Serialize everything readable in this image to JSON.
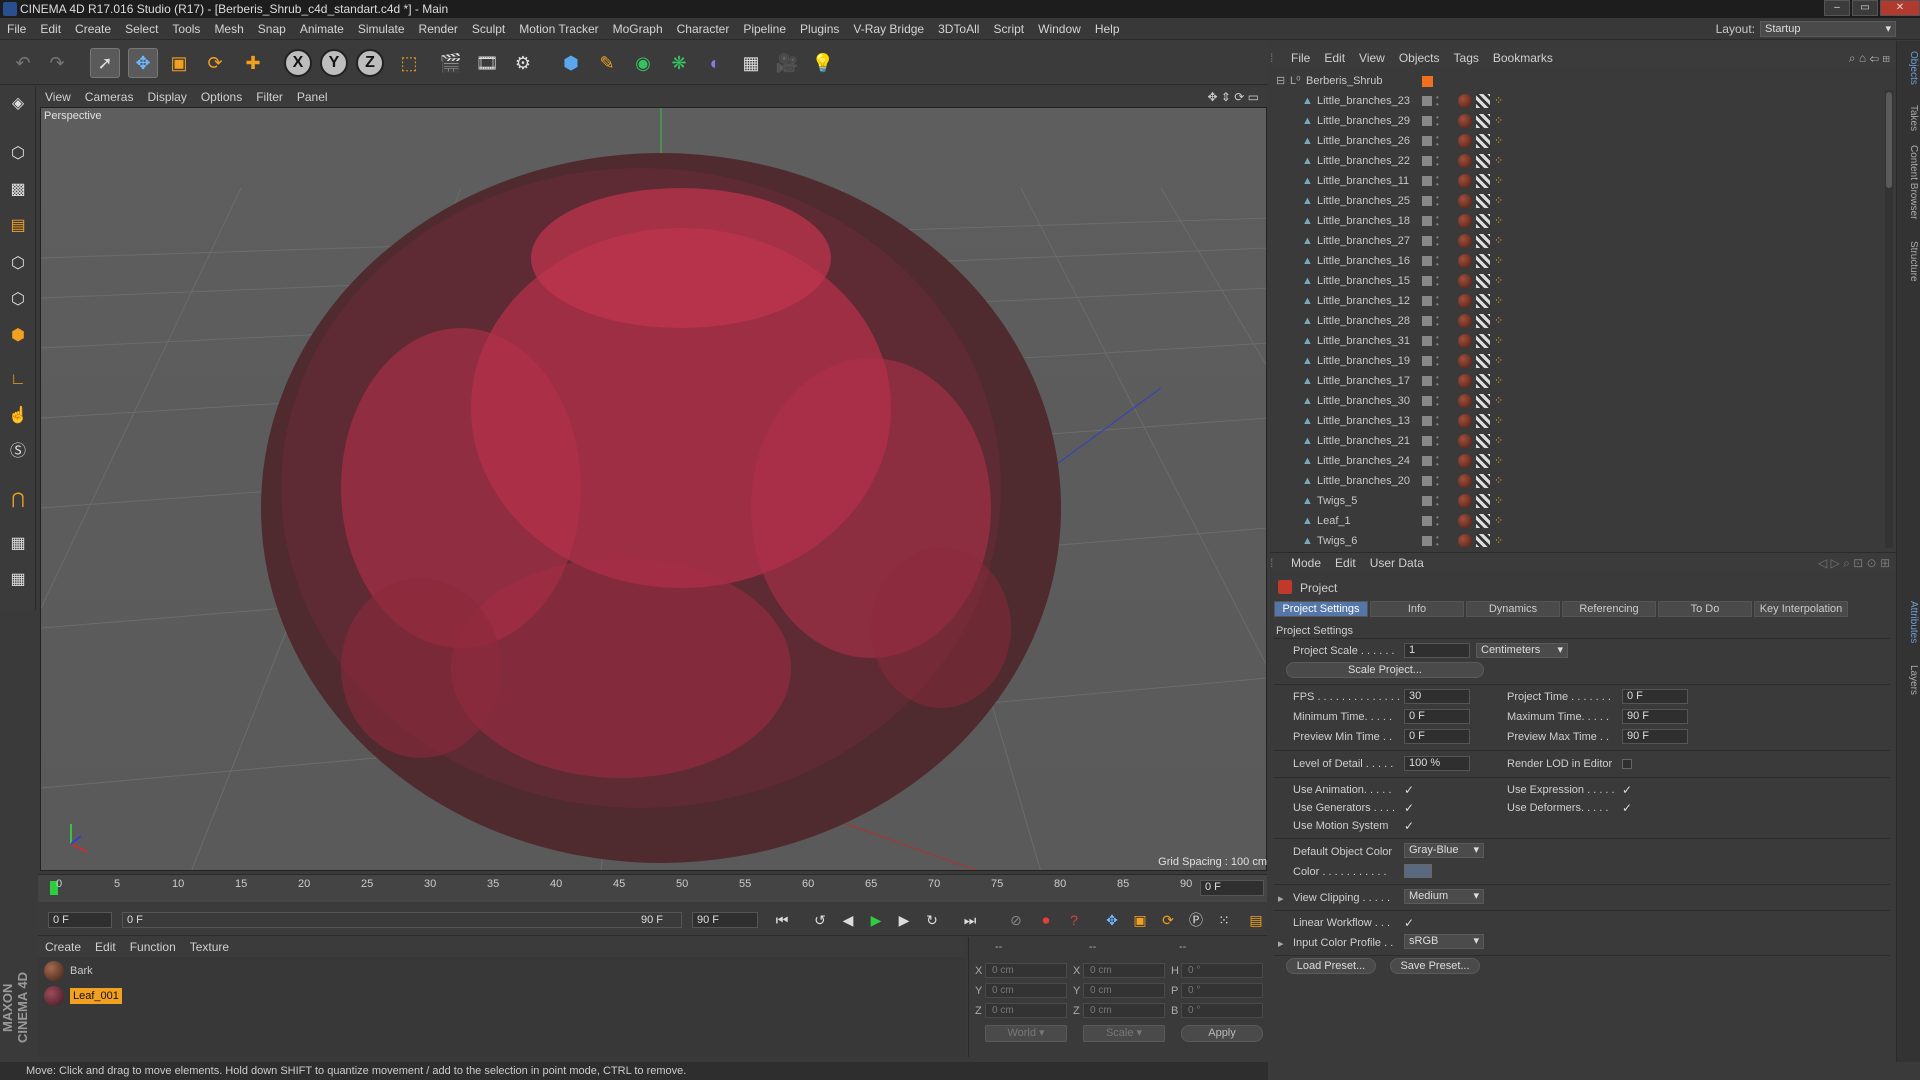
{
  "window": {
    "title": "CINEMA 4D R17.016 Studio (R17) - [Berberis_Shrub_c4d_standart.c4d *] - Main",
    "controls": [
      "–",
      "▭",
      "✕"
    ]
  },
  "menubar": {
    "items": [
      "File",
      "Edit",
      "Create",
      "Select",
      "Tools",
      "Mesh",
      "Snap",
      "Animate",
      "Simulate",
      "Render",
      "Sculpt",
      "Motion Tracker",
      "MoGraph",
      "Character",
      "Pipeline",
      "Plugins",
      "V-Ray Bridge",
      "3DToAll",
      "Script",
      "Window",
      "Help"
    ],
    "layout_label": "Layout:",
    "layout_value": "Startup"
  },
  "top_toolbar": {
    "icons": [
      "undo-icon",
      "redo-icon",
      "live-selection-icon",
      "move-icon",
      "scale-icon",
      "rotate-icon",
      "add-icon",
      "x-axis-icon",
      "y-axis-icon",
      "z-axis-icon",
      "coordinate-system-icon",
      "render-view-icon",
      "render-picture-viewer-icon",
      "edit-render-settings-icon",
      "cube-icon",
      "pen-icon",
      "subdivision-icon",
      "cloner-icon",
      "deformer-icon",
      "floor-icon",
      "camera-icon",
      "light-icon"
    ],
    "axis_labels": [
      "X",
      "Y",
      "Z"
    ]
  },
  "viewport": {
    "menus": [
      "View",
      "Cameras",
      "Display",
      "Options",
      "Filter",
      "Panel"
    ],
    "label": "Perspective",
    "grid_spacing": "Grid Spacing : 100 cm"
  },
  "timeline": {
    "ticks": [
      "0",
      "5",
      "10",
      "15",
      "20",
      "25",
      "30",
      "35",
      "40",
      "45",
      "50",
      "55",
      "60",
      "65",
      "70",
      "75",
      "80",
      "85",
      "90"
    ],
    "current_frame": "0 F",
    "start_field": "0 F",
    "range_start": "0 F",
    "range_end": "90 F",
    "end_field": "90 F"
  },
  "material_manager": {
    "menus": [
      "Create",
      "Edit",
      "Function",
      "Texture"
    ],
    "materials": [
      {
        "name": "Bark",
        "color": "#6b3a2a"
      },
      {
        "name": "Leaf_001",
        "color": "#7a2a3a"
      }
    ]
  },
  "coordinates": {
    "headers": [
      "--",
      "--",
      "--"
    ],
    "rows": [
      {
        "a": "X",
        "a_val": "0 cm",
        "b": "X",
        "b_val": "0 cm",
        "c": "H",
        "c_val": "0 °"
      },
      {
        "a": "Y",
        "a_val": "0 cm",
        "b": "Y",
        "b_val": "0 cm",
        "c": "P",
        "c_val": "0 °"
      },
      {
        "a": "Z",
        "a_val": "0 cm",
        "b": "Z",
        "b_val": "0 cm",
        "c": "B",
        "c_val": "0 °"
      }
    ],
    "world": "World",
    "scale": "Scale",
    "apply": "Apply"
  },
  "status_bar": {
    "text": "Move: Click and drag to move elements. Hold down SHIFT to quantize movement / add to the selection in point mode, CTRL to remove."
  },
  "object_manager": {
    "menus": [
      "File",
      "Edit",
      "View",
      "Objects",
      "Tags",
      "Bookmarks"
    ],
    "root": "Berberis_Shrub",
    "objects": [
      "Little_branches_23",
      "Little_branches_29",
      "Little_branches_26",
      "Little_branches_22",
      "Little_branches_11",
      "Little_branches_25",
      "Little_branches_18",
      "Little_branches_27",
      "Little_branches_16",
      "Little_branches_15",
      "Little_branches_12",
      "Little_branches_28",
      "Little_branches_31",
      "Little_branches_19",
      "Little_branches_17",
      "Little_branches_30",
      "Little_branches_13",
      "Little_branches_21",
      "Little_branches_24",
      "Little_branches_20",
      "Twigs_5",
      "Leaf_1",
      "Twigs_6"
    ]
  },
  "attributes": {
    "menus": [
      "Mode",
      "Edit",
      "User Data"
    ],
    "object_label": "Project",
    "tabs": [
      "Project Settings",
      "Info",
      "Dynamics",
      "Referencing",
      "To Do",
      "Key Interpolation"
    ],
    "section": "Project Settings",
    "project_scale_label": "Project Scale . . . . . .",
    "project_scale_value": "1",
    "project_scale_unit": "Centimeters",
    "scale_project_button": "Scale Project...",
    "fps_label": "FPS . . . . . . . . . . . . . . .",
    "fps_value": "30",
    "project_time_label": "Project Time . . . . . . .",
    "project_time_value": "0 F",
    "min_time_label": "Minimum Time. . . . .",
    "min_time_value": "0 F",
    "max_time_label": "Maximum Time. . . . .",
    "max_time_value": "90 F",
    "preview_min_label": "Preview Min Time . .",
    "preview_min_value": "0 F",
    "preview_max_label": "Preview Max Time . .",
    "preview_max_value": "90 F",
    "lod_label": "Level of Detail . . . . .",
    "lod_value": "100 %",
    "render_lod_label": "Render LOD in Editor",
    "use_animation_label": "Use Animation. . . . .",
    "use_expression_label": "Use Expression . . . . .",
    "use_generators_label": "Use Generators . . . .",
    "use_deformers_label": "Use Deformers. . . . .",
    "use_motion_label": "Use Motion System",
    "default_color_label": "Default Object Color",
    "default_color_value": "Gray-Blue",
    "color_label": "Color . . . . . . . . . . .",
    "view_clipping_label": "View Clipping . . . . .",
    "view_clipping_value": "Medium",
    "linear_workflow_label": "Linear Workflow . . .",
    "input_color_label": "Input Color Profile . .",
    "input_color_value": "sRGB",
    "load_preset": "Load Preset...",
    "save_preset": "Save Preset...",
    "check": "✓"
  },
  "right_tabs": [
    "Objects",
    "Takes",
    "Content Browser",
    "Structure",
    "Attributes",
    "Layers"
  ],
  "colors": {
    "accent_blue": "#5476a8",
    "timeline_green": "#2ecc40",
    "shrub_red": "#c2344f",
    "shrub_dark": "#5a2a30"
  }
}
